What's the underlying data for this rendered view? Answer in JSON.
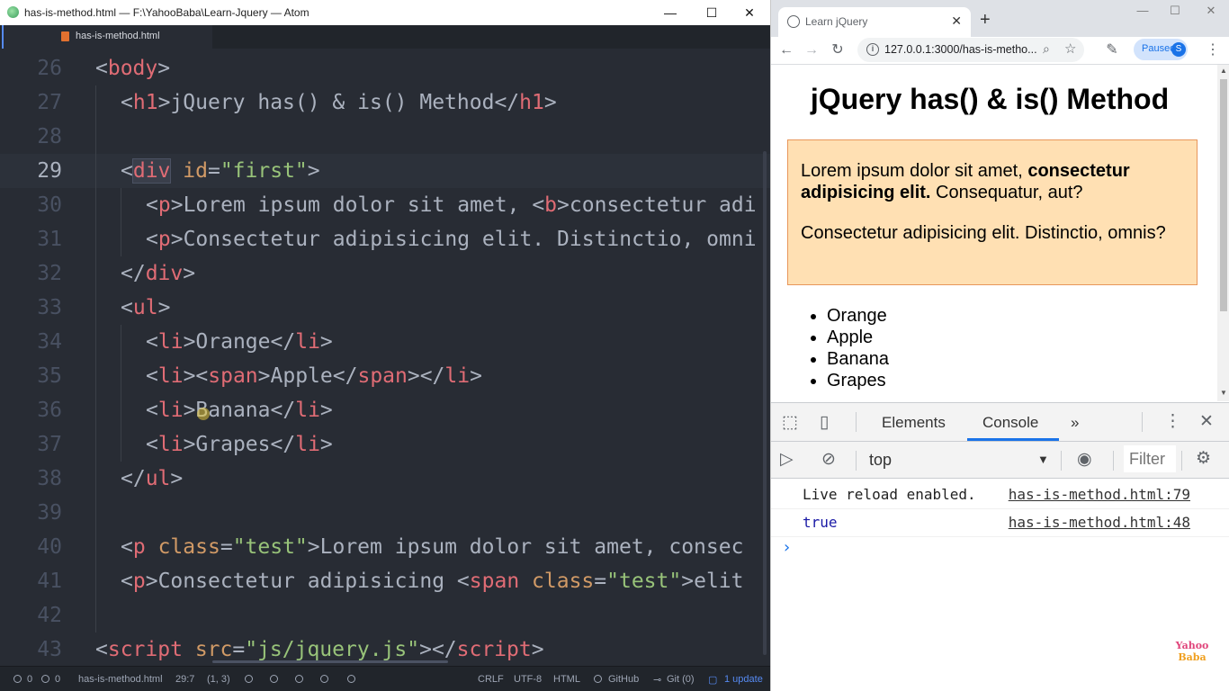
{
  "atom": {
    "window_title": "has-is-method.html — F:\\YahooBaba\\Learn-Jquery — Atom",
    "tab_label": "has-is-method.html",
    "controls": {
      "minimize": "—",
      "maximize": "☐",
      "close": "✕"
    },
    "line_numbers": [
      "26",
      "27",
      "28",
      "29",
      "30",
      "31",
      "32",
      "33",
      "34",
      "35",
      "36",
      "37",
      "38",
      "39",
      "40",
      "41",
      "42",
      "43"
    ],
    "code": {
      "l26": [
        "<",
        "body",
        ">"
      ],
      "l27": [
        "<",
        "h1",
        ">",
        "jQuery has() & is() Method",
        "</",
        "h1",
        ">"
      ],
      "l29": [
        "<",
        "div",
        " ",
        "id",
        "=",
        "\"first\"",
        ">"
      ],
      "l30": [
        "<",
        "p",
        ">",
        "Lorem ipsum dolor sit amet, ",
        "<",
        "b",
        ">",
        "consectetur adi"
      ],
      "l31": [
        "<",
        "p",
        ">",
        "Consectetur adipisicing elit. Distinctio, omni"
      ],
      "l32": [
        "</",
        "div",
        ">"
      ],
      "l33": [
        "<",
        "ul",
        ">"
      ],
      "l34": [
        "<",
        "li",
        ">",
        "Orange",
        "</",
        "li",
        ">"
      ],
      "l35": [
        "<",
        "li",
        "><",
        "span",
        ">",
        "Apple",
        "</",
        "span",
        "></",
        "li",
        ">"
      ],
      "l36": [
        "<",
        "li",
        ">",
        "Banana",
        "</",
        "li",
        ">"
      ],
      "l37": [
        "<",
        "li",
        ">",
        "Grapes",
        "</",
        "li",
        ">"
      ],
      "l38": [
        "</",
        "ul",
        ">"
      ],
      "l40": [
        "<",
        "p",
        " ",
        "class",
        "=",
        "\"test\"",
        ">",
        "Lorem ipsum dolor sit amet, consec"
      ],
      "l41": [
        "<",
        "p",
        ">",
        "Consectetur adipisicing ",
        "<",
        "span",
        " ",
        "class",
        "=",
        "\"test\"",
        ">",
        "elit"
      ],
      "l43": [
        "<",
        "script",
        " ",
        "src",
        "=",
        "\"js/jquery.js\"",
        "></",
        "script",
        ">"
      ]
    },
    "status": {
      "errors": "0",
      "warnings": "0",
      "file": "has-is-method.html",
      "cursor": "29:7",
      "selection": "(1, 3)",
      "line_ending": "CRLF",
      "encoding": "UTF-8",
      "grammar": "HTML",
      "github": "GitHub",
      "git": "Git (0)",
      "update": "1 update"
    }
  },
  "chrome": {
    "tab_title": "Learn jQuery",
    "new_tab": "+",
    "url": "127.0.0.1:3000/has-is-metho...",
    "profile_label": "Paused",
    "profile_initial": "S",
    "page": {
      "heading": "jQuery has() & is() Method",
      "p1_text": "Lorem ipsum dolor sit amet, ",
      "p1_bold": "consectetur adipisicing elit.",
      "p1_rest": " Consequatur, aut?",
      "p2_text": "Consectetur adipisicing elit. Distinctio, omnis?",
      "fruits": [
        "Orange",
        "Apple",
        "Banana",
        "Grapes"
      ]
    },
    "devtools": {
      "tabs": [
        "Elements",
        "Console"
      ],
      "more": "»",
      "context": "top",
      "filter_placeholder": "Filter",
      "messages": [
        {
          "text": "Live reload enabled.",
          "source": "has-is-method.html:79"
        },
        {
          "text": "true",
          "source": "has-is-method.html:48"
        }
      ],
      "prompt": "›"
    },
    "watermark": [
      "Yahoo",
      "Baba"
    ]
  },
  "colors": {
    "editor_bg": "#282c34",
    "tag": "#e06c75",
    "attr": "#d19a66",
    "string": "#98c379",
    "text": "#abb2bf",
    "div_bg": "#ffe0b3",
    "div_border": "#e8965a",
    "accent": "#1a73e8"
  }
}
